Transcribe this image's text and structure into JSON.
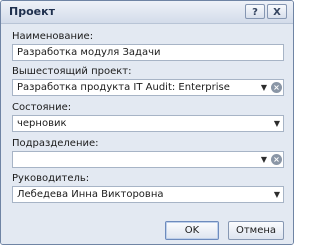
{
  "window": {
    "title": "Проект",
    "help_label": "?",
    "close_label": "X"
  },
  "form": {
    "name_label": "Наименование:",
    "name_value": "Разработка модуля Задачи",
    "parent_label": "Вышестоящий проект:",
    "parent_value": "Разработка продукта IT Audit: Enterprise",
    "state_label": "Состояние:",
    "state_value": "черновик",
    "department_label": "Подразделение:",
    "department_value": "",
    "manager_label": "Руководитель:",
    "manager_value": "Лебедева Инна Викторовна"
  },
  "buttons": {
    "ok": "OK",
    "cancel": "Отмена"
  },
  "icons": {
    "dropdown": "▼",
    "clear": "×"
  }
}
